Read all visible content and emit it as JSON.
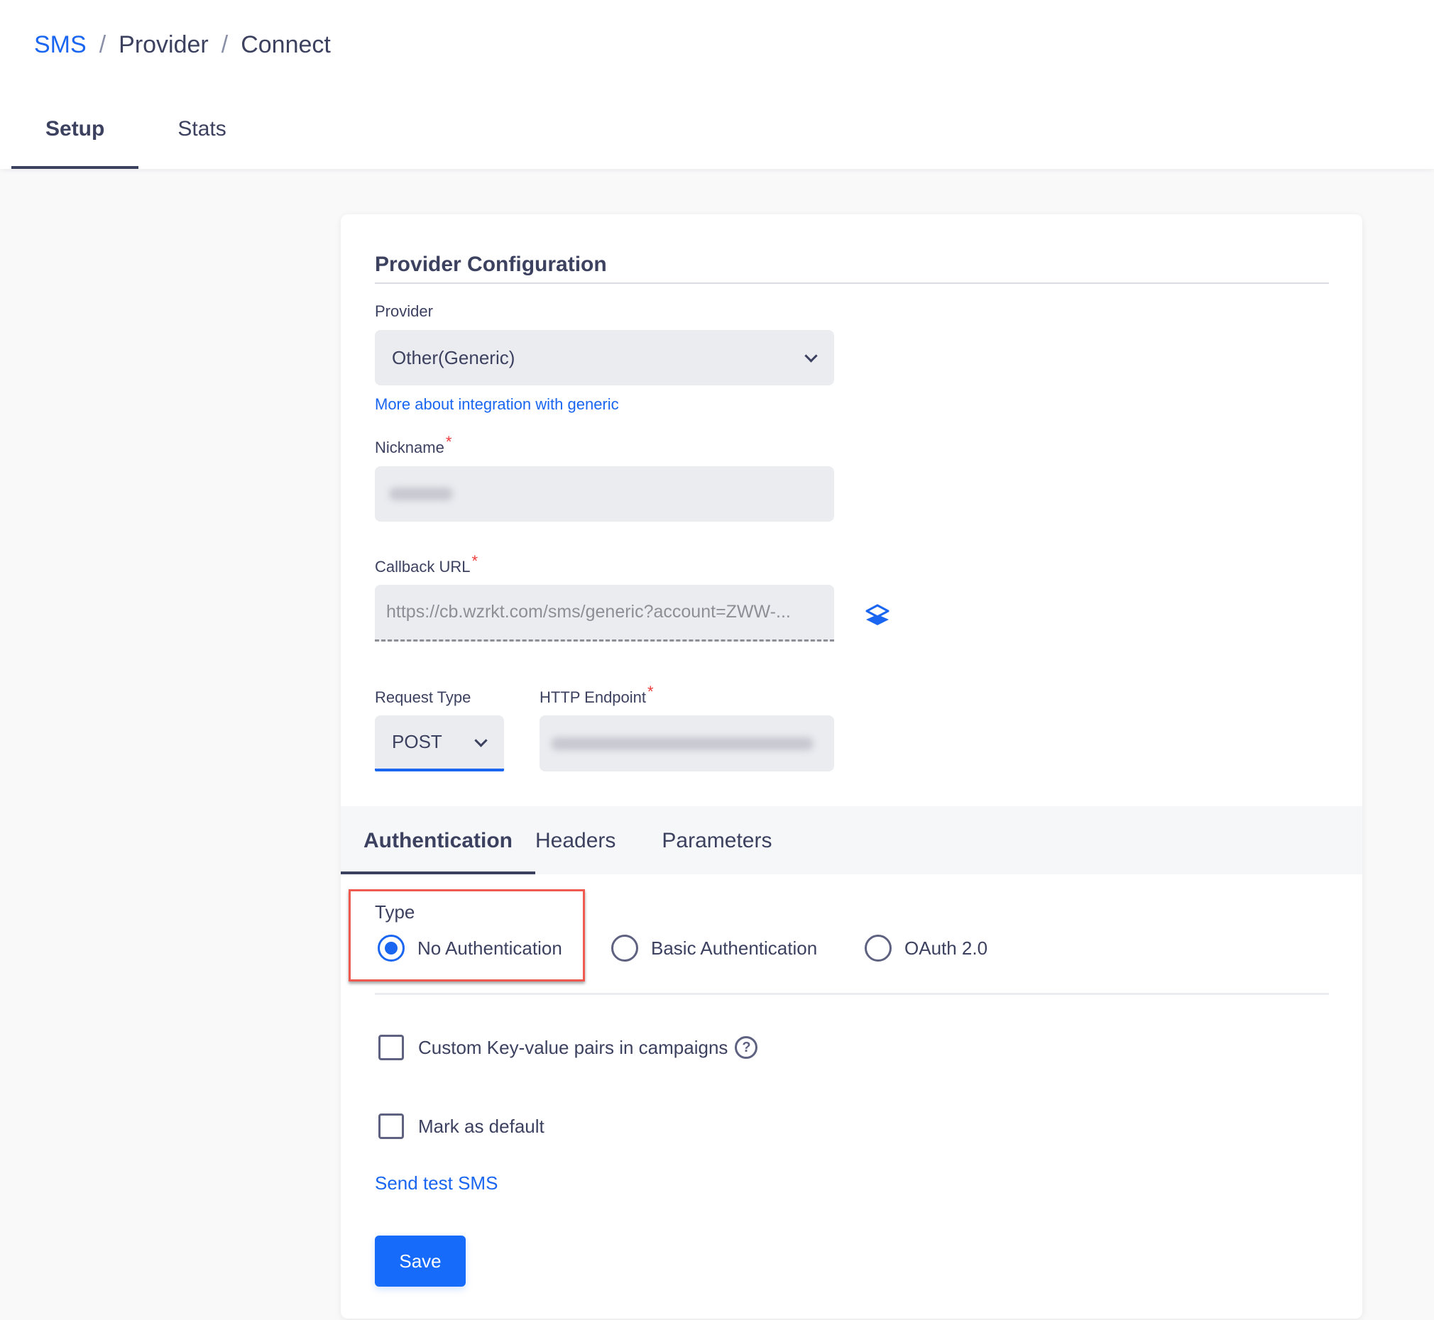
{
  "breadcrumb": {
    "items": [
      "SMS",
      "Provider",
      "Connect"
    ],
    "separator": "/"
  },
  "page_tabs": [
    {
      "label": "Setup",
      "active": true
    },
    {
      "label": "Stats",
      "active": false
    }
  ],
  "provider_config": {
    "title": "Provider Configuration",
    "provider": {
      "label": "Provider",
      "value": "Other(Generic)",
      "icon": "chevron-down-icon"
    },
    "integration_link": "More about integration with generic",
    "nickname": {
      "label": "Nickname",
      "required_mark": "*",
      "value_redacted": true
    },
    "callback_url": {
      "label": "Callback URL",
      "required_mark": "*",
      "value": "https://cb.wzrkt.com/sms/generic?account=ZWW-...",
      "copy_icon": "copy-icon"
    },
    "request_type": {
      "label": "Request Type",
      "value": "POST",
      "icon": "chevron-down-icon"
    },
    "http_endpoint": {
      "label": "HTTP Endpoint",
      "required_mark": "*",
      "value_redacted": true
    }
  },
  "config_tabs": [
    {
      "label": "Authentication",
      "active": true
    },
    {
      "label": "Headers",
      "active": false
    },
    {
      "label": "Parameters",
      "active": false
    }
  ],
  "authentication": {
    "type_label": "Type",
    "options": [
      {
        "label": "No Authentication",
        "selected": true
      },
      {
        "label": "Basic Authentication",
        "selected": false
      },
      {
        "label": "OAuth 2.0",
        "selected": false
      }
    ]
  },
  "options": {
    "custom_kv": {
      "label": "Custom Key-value pairs in campaigns",
      "checked": false,
      "help_glyph": "?"
    },
    "mark_default": {
      "label": "Mark as default",
      "checked": false
    }
  },
  "send_test_link": "Send test SMS",
  "save_button": "Save",
  "colors": {
    "accent": "#1a66f0",
    "primary_button": "#176bfb",
    "text": "#3d4160",
    "required": "#ee3b3b",
    "highlight": "#ee5a4f"
  }
}
